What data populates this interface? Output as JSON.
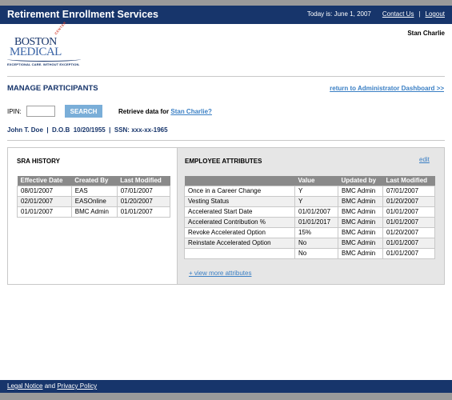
{
  "header": {
    "title": "Retirement Enrollment Services",
    "date_text": "Today is: June 1, 2007",
    "contact_label": "Contact Us",
    "separator": "|",
    "logout_label": "Logout"
  },
  "user": {
    "name": "Stan Charlie"
  },
  "logo": {
    "line1": "BOSTON",
    "line2": "MEDICAL",
    "center_label": "CENTER",
    "tagline": "EXCEPTIONAL CARE. WITHOUT EXCEPTION."
  },
  "page": {
    "title": "MANAGE PARTICIPANTS",
    "return_link": "return to Administrator Dashboard >>"
  },
  "search": {
    "ipin_label": "IPIN:",
    "ipin_value": "",
    "button_label": "SEARCH",
    "retrieve_prefix": "Retrieve data for",
    "retrieve_name": "Stan Charlie?"
  },
  "person": {
    "info": "John T. Doe  |  D.O.B  10/20/1955  |  SSN: xxx-xx-1965"
  },
  "sra": {
    "heading": "SRA HISTORY",
    "columns": [
      "Effective Date",
      "Created By",
      "Last Modified"
    ],
    "rows": [
      [
        "08/01/2007",
        "EAS",
        "07/01/2007"
      ],
      [
        "02/01/2007",
        "EASOnline",
        "01/20/2007"
      ],
      [
        "01/01/2007",
        "BMC Admin",
        "01/01/2007"
      ]
    ]
  },
  "employee": {
    "heading": "EMPLOYEE ATTRIBUTES",
    "edit_label": "edit",
    "columns": [
      "",
      "Value",
      "Updated by",
      "Last Modified"
    ],
    "rows": [
      [
        "Once in a Career Change",
        "Y",
        "BMC Admin",
        "07/01/2007"
      ],
      [
        "Vesting Status",
        "Y",
        "BMC Admin",
        "01/20/2007"
      ],
      [
        "Accelerated Start Date",
        "01/01/2007",
        "BMC Admin",
        "01/01/2007"
      ],
      [
        "Accelerated Contribution %",
        "01/01/2017",
        "BMC Admin",
        "01/01/2007"
      ],
      [
        "Revoke Accelerated Option",
        "15%",
        "BMC Admin",
        "01/20/2007"
      ],
      [
        "Reinstate Accelerated Option",
        "No",
        "BMC Admin",
        "01/01/2007"
      ],
      [
        "",
        "No",
        "BMC Admin",
        "01/01/2007"
      ]
    ],
    "view_more": "+ view more attributes"
  },
  "footer": {
    "legal_label": "Legal Notice",
    "and_text": "and",
    "privacy_label": "Privacy Policy"
  },
  "colors": {
    "navy": "#17356b",
    "link": "#3a7fc4",
    "button": "#7aaed8",
    "table_header": "#8a8a8a"
  }
}
